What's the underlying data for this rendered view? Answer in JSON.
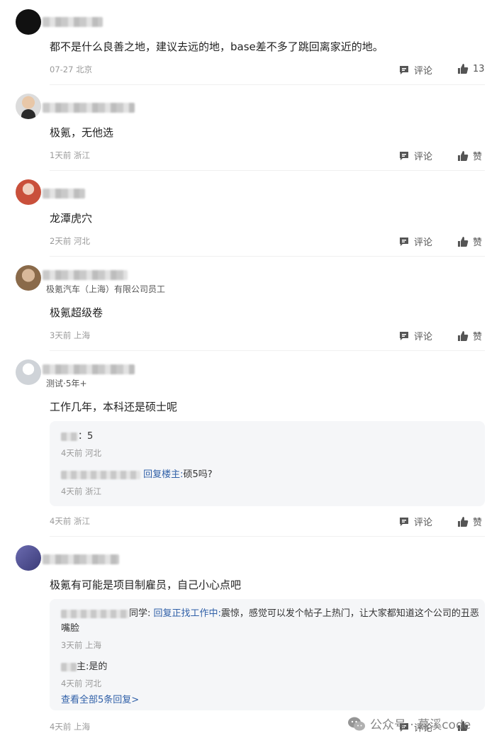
{
  "actions": {
    "comment_label": "评论",
    "like_label": "赞"
  },
  "comments": [
    {
      "text": "都不是什么良善之地，建议去远的地，base差不多了跳回离家近的地。",
      "date": "07-27",
      "location": "北京",
      "likes": "13"
    },
    {
      "text": "极氪，无他选",
      "date": "1天前",
      "location": "浙江"
    },
    {
      "text": "龙潭虎穴",
      "date": "2天前",
      "location": "河北"
    },
    {
      "subtitle": "极氪汽车（上海）有限公司员工",
      "text": "极氪超级卷",
      "date": "3天前",
      "location": "上海"
    },
    {
      "subtitle": "测试·5年+",
      "text": "工作几年，本科还是硕士呢",
      "date": "4天前",
      "location": "浙江",
      "replies": [
        {
          "text": "：5",
          "date": "4天前",
          "location": "河北"
        },
        {
          "reply_to": "回复楼主:",
          "text": "硕5吗?",
          "date": "4天前",
          "location": "浙江"
        }
      ]
    },
    {
      "text": "极氪有可能是项目制雇员，自己小心点吧",
      "date": "4天前",
      "location": "上海",
      "replies": [
        {
          "prefix": "同学:",
          "reply_to": "回复正找工作中:",
          "text": "震惊，感觉可以发个帖子上热门，让大家都知道这个公司的丑恶嘴脸",
          "date": "3天前",
          "location": "上海"
        },
        {
          "prefix": "主:",
          "text": "是的",
          "date": "4天前",
          "location": "河北"
        }
      ],
      "view_all": "查看全部5条回复>"
    }
  ],
  "watermark": "公众号 · 慕溪code",
  "icons": [
    "comment-icon",
    "thumbs-up-icon",
    "wechat-icon"
  ]
}
